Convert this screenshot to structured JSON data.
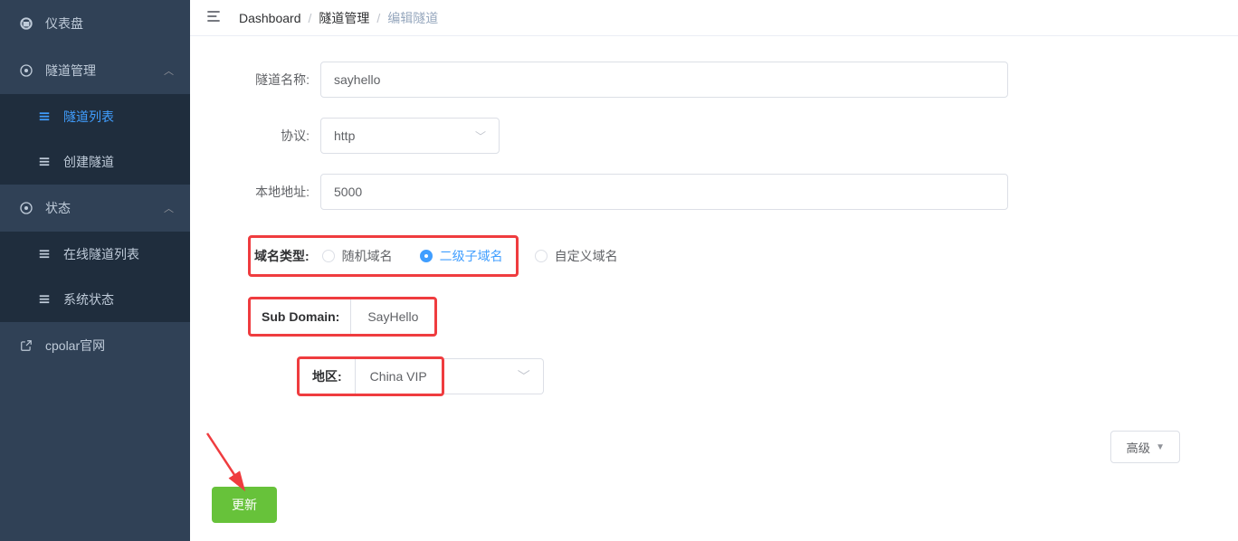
{
  "sidebar": {
    "items": [
      {
        "label": "仪表盘",
        "icon": "dashboard"
      },
      {
        "label": "隧道管理",
        "icon": "tunnel",
        "expandable": true
      },
      {
        "label": "隧道列表",
        "sub": true,
        "active": true,
        "icon": "list"
      },
      {
        "label": "创建隧道",
        "sub": true,
        "icon": "list"
      },
      {
        "label": "状态",
        "icon": "status",
        "expandable": true
      },
      {
        "label": "在线隧道列表",
        "sub": true,
        "icon": "list"
      },
      {
        "label": "系统状态",
        "sub": true,
        "icon": "list"
      },
      {
        "label": "cpolar官网",
        "icon": "external"
      }
    ]
  },
  "breadcrumb": {
    "items": [
      "Dashboard",
      "隧道管理",
      "编辑隧道"
    ]
  },
  "form": {
    "tunnel_name_label": "隧道名称:",
    "tunnel_name_value": "sayhello",
    "protocol_label": "协议:",
    "protocol_value": "http",
    "local_addr_label": "本地地址:",
    "local_addr_value": "5000",
    "domain_type_label": "域名类型:",
    "domain_type_options": {
      "random": "随机域名",
      "subdomain": "二级子域名",
      "custom": "自定义域名"
    },
    "domain_type_selected": "subdomain",
    "sub_domain_label": "Sub Domain:",
    "sub_domain_value": "SayHello",
    "region_label": "地区:",
    "region_value": "China VIP",
    "advanced_label": "高级",
    "update_label": "更新"
  },
  "colors": {
    "highlight": "#ef3c3f",
    "primary": "#409eff",
    "success": "#67c23a",
    "sidebar_bg": "#304156"
  }
}
